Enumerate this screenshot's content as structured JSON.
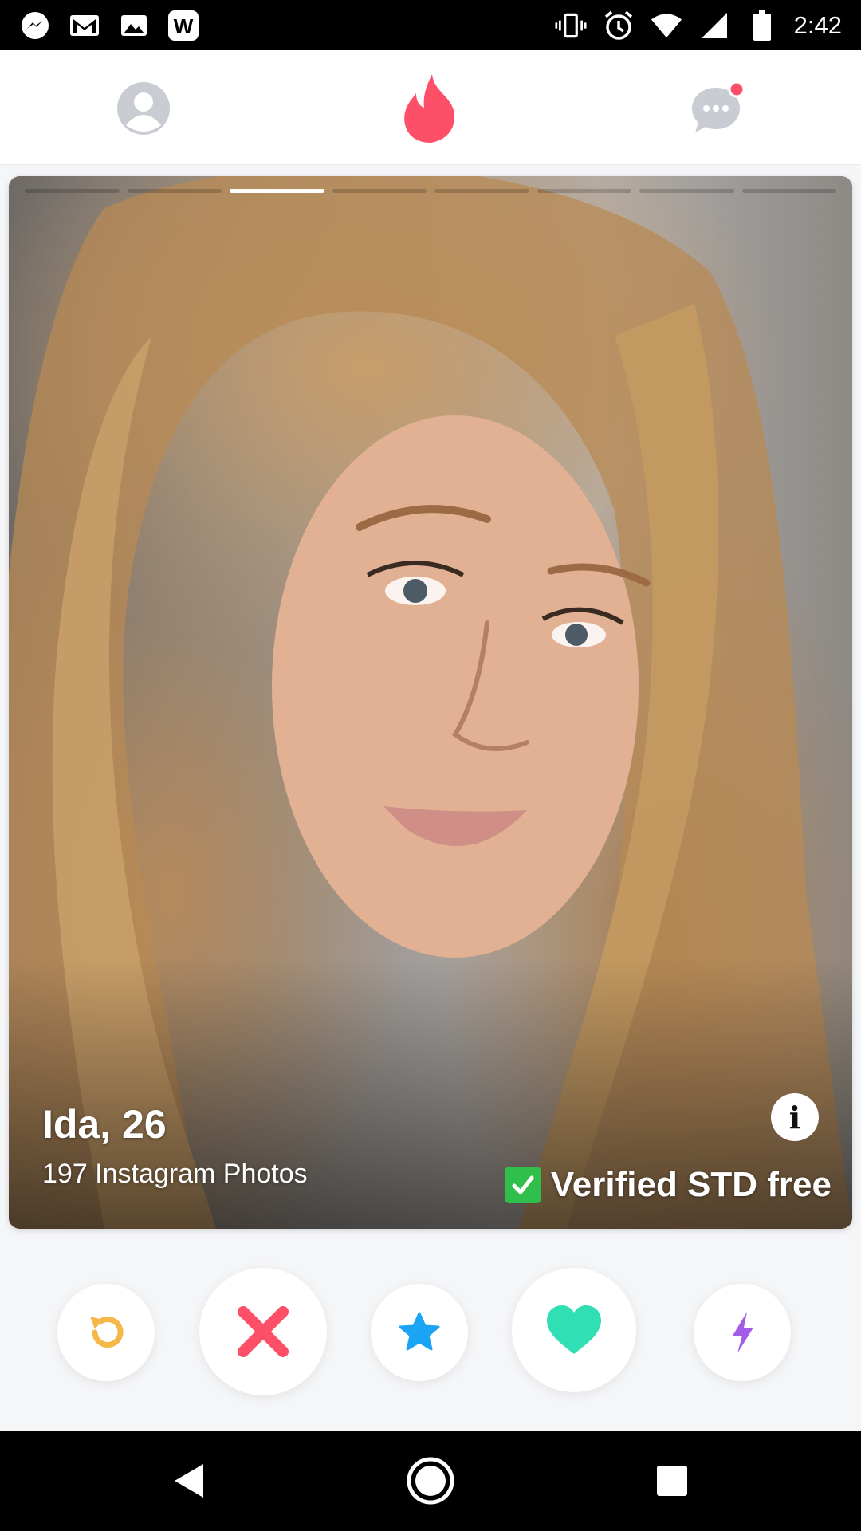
{
  "status_bar": {
    "time": "2:42",
    "left_icons": [
      "messenger-icon",
      "gmail-icon",
      "image-icon",
      "w-app-icon"
    ],
    "right_icons": [
      "vibrate-icon",
      "alarm-icon",
      "wifi-icon",
      "signal-icon",
      "battery-icon"
    ],
    "w_app_letter": "W"
  },
  "top_nav": {
    "profile_icon": "profile-icon",
    "home_icon": "flame-icon",
    "messages_icon": "chat-icon",
    "messages_badge": true,
    "accent_color": "#fd5068"
  },
  "profile_card": {
    "photo_count": 8,
    "active_photo_index": 2,
    "name_age": "Ida, 26",
    "subtitle": "197 Instagram Photos",
    "info_label": "i",
    "verified_text": "Verified STD free"
  },
  "actions": [
    {
      "name": "rewind",
      "icon": "rewind-icon",
      "color": "#f5b748"
    },
    {
      "name": "nope",
      "icon": "x-icon",
      "color": "#fd5068"
    },
    {
      "name": "super-like",
      "icon": "star-icon",
      "color": "#1ca4f4"
    },
    {
      "name": "like",
      "icon": "heart-icon",
      "color": "#30e0b4"
    },
    {
      "name": "boost",
      "icon": "bolt-icon",
      "color": "#a45ce8"
    }
  ],
  "system_nav": {
    "back_icon": "back-icon",
    "home_icon": "home-circle-icon",
    "recents_icon": "recents-icon"
  }
}
